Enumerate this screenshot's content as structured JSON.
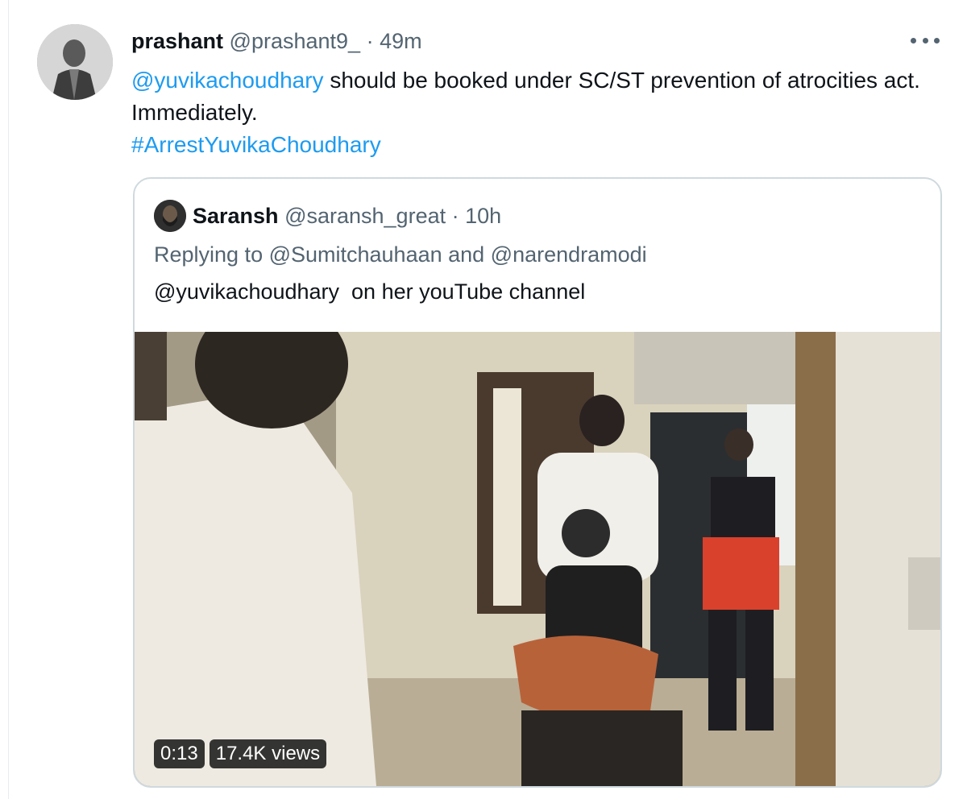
{
  "tweet": {
    "author_name": "prashant",
    "author_handle": "@prashant9_",
    "separator": "·",
    "time": "49m",
    "mention": "@yuvikachoudhary",
    "text_part1": " should be booked under SC/ST prevention of atrocities act. Immediately.",
    "hashtag": "#ArrestYuvikaChoudhary",
    "more_icon": "more-horizontal-icon"
  },
  "quoted_tweet": {
    "author_name": "Saransh",
    "author_handle": "@saransh_great",
    "separator": "·",
    "time": "10h",
    "replying_to": "Replying to @Sumitchauhaan and @narendramodi",
    "body": "@yuvikachoudhary  on her youTube channel",
    "video": {
      "duration": "0:13",
      "views": "17.4K views"
    }
  },
  "colors": {
    "link": "#1d9bf0",
    "muted": "#536471",
    "border": "#cfd9de"
  }
}
